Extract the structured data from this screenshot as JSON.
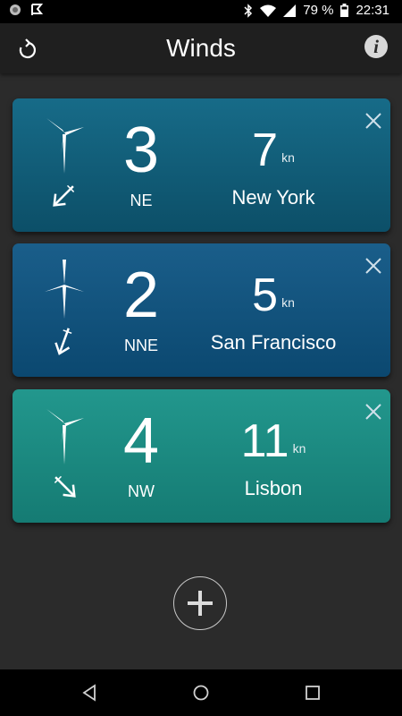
{
  "status_bar": {
    "battery_percent": "79 %",
    "time": "22:31",
    "icons": [
      "notification-circle-icon",
      "notification-flag-icon",
      "bluetooth-icon",
      "wifi-icon",
      "signal-icon",
      "battery-icon"
    ]
  },
  "app_bar": {
    "title": "Winds",
    "refresh_icon": "refresh-icon",
    "info_label": "i"
  },
  "cards": [
    {
      "beaufort": "3",
      "direction": "NE",
      "speed": "7",
      "unit": "kn",
      "city": "New York",
      "color": "#176b88",
      "arrow_rotation_deg": 225
    },
    {
      "beaufort": "2",
      "direction": "NNE",
      "speed": "5",
      "unit": "kn",
      "city": "San Francisco",
      "color": "#1a5e8a",
      "arrow_rotation_deg": 200
    },
    {
      "beaufort": "4",
      "direction": "NW",
      "speed": "11",
      "unit": "kn",
      "city": "Lisbon",
      "color": "#22978d",
      "arrow_rotation_deg": 135
    }
  ],
  "add_button_icon": "plus-icon",
  "nav_bar": {
    "icons": [
      "back-icon",
      "home-icon",
      "recents-icon"
    ]
  }
}
